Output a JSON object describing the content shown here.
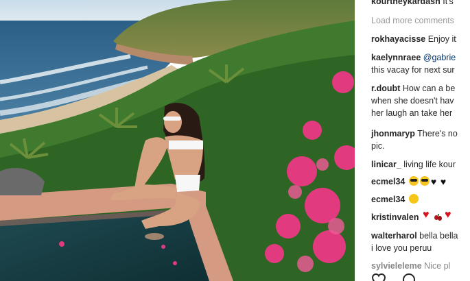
{
  "post": {
    "comments": [
      {
        "user": "kourtneykardash",
        "text": "It's"
      },
      {
        "type": "load_more",
        "text": "Load more comments"
      },
      {
        "user": "rokhayacisse",
        "text": "Enjoy it"
      },
      {
        "user": "kaelynnraee",
        "mention": "@gabrie",
        "text_line2": "this vacay for next sur"
      },
      {
        "user": "r.doubt",
        "text": "How can a be",
        "text_line2": "when she doesn't hav",
        "text_line3": "her laugh an take her"
      },
      {
        "user": "jhonmaryp",
        "text": "There's no",
        "text_line2": "pic."
      },
      {
        "user": "linicar_",
        "text": "living life kour"
      },
      {
        "user": "ecmel34",
        "emojis": [
          "sunglasses-face-emoji",
          "sunglasses-face-emoji",
          "black-heart-emoji",
          "black-heart-emoji"
        ]
      },
      {
        "user": "ecmel34",
        "emojis": [
          "thinking-face-emoji"
        ]
      },
      {
        "user": "kristinvalen",
        "emojis": [
          "red-heart-emoji",
          "cherries-emoji",
          "red-heart-emoji"
        ]
      },
      {
        "user": "walterharol",
        "text": "bella bella",
        "text_line2": "i love you peruu"
      },
      {
        "user": "sylvieleleme",
        "text": "Nice pl"
      }
    ],
    "actions": [
      "heart-icon",
      "comment-icon"
    ]
  }
}
